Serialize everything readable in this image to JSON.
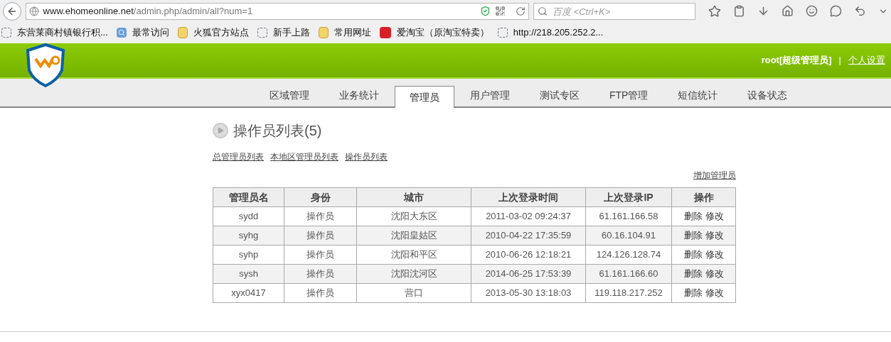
{
  "browser": {
    "url_host": "www.ehomeonline.net",
    "url_path": "/admin.php/admin/all?num=1",
    "search_placeholder": "百度 <Ctrl+K>"
  },
  "bookmarks": [
    {
      "label": "东营莱商村镇银行积...",
      "kind": "blank"
    },
    {
      "label": "最常访问",
      "kind": "search"
    },
    {
      "label": "火狐官方站点",
      "kind": "folder"
    },
    {
      "label": "新手上路",
      "kind": "blank"
    },
    {
      "label": "常用网址",
      "kind": "folder"
    },
    {
      "label": "爱淘宝（原淘宝特卖）",
      "kind": "taobao"
    },
    {
      "label": "http://218.205.252.2...",
      "kind": "blank"
    }
  ],
  "header": {
    "user": "root[超级管理员]",
    "separator": "|",
    "settings_link": "个人设置"
  },
  "tabs": [
    {
      "label": "区域管理",
      "selected": false
    },
    {
      "label": "业务统计",
      "selected": false
    },
    {
      "label": "管理员",
      "selected": true
    },
    {
      "label": "用户管理",
      "selected": false
    },
    {
      "label": "测试专区",
      "selected": false
    },
    {
      "label": "FTP管理",
      "selected": false
    },
    {
      "label": "短信统计",
      "selected": false
    },
    {
      "label": "设备状态",
      "selected": false
    }
  ],
  "page_title": "操作员列表(5)",
  "sub_links": [
    "总管理员列表",
    "本地区管理员列表",
    "操作员列表"
  ],
  "add_link": "增加管理员",
  "table": {
    "columns": [
      "管理员名",
      "身份",
      "城市",
      "上次登录时间",
      "上次登录IP",
      "操作"
    ],
    "rows": [
      {
        "cells": [
          "sydd",
          "操作员",
          "沈阳大东区",
          "2011-03-02 09:24:37",
          "61.161.166.58"
        ],
        "actions": [
          "删除",
          "修改"
        ]
      },
      {
        "cells": [
          "syhg",
          "操作员",
          "沈阳皇姑区",
          "2010-04-22 17:35:59",
          "60.16.104.91"
        ],
        "actions": [
          "删除",
          "修改"
        ]
      },
      {
        "cells": [
          "syhp",
          "操作员",
          "沈阳和平区",
          "2010-06-26 12:18:21",
          "124.126.128.74"
        ],
        "actions": [
          "删除",
          "修改"
        ]
      },
      {
        "cells": [
          "sysh",
          "操作员",
          "沈阳沈河区",
          "2014-06-25 17:53:39",
          "61.161.166.60"
        ],
        "actions": [
          "删除",
          "修改"
        ]
      },
      {
        "cells": [
          "xyx0417",
          "操作员",
          "营口",
          "2013-05-30 13:18:03",
          "119.118.217.252"
        ],
        "actions": [
          "删除",
          "修改"
        ]
      }
    ]
  }
}
